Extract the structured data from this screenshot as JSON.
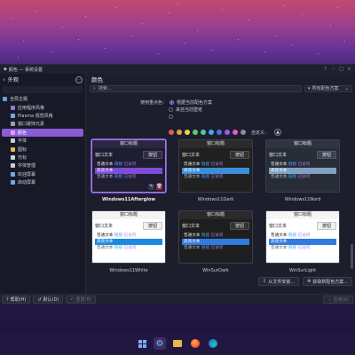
{
  "window": {
    "title": "颜色 — 系统设置",
    "title_icon": "palette-icon"
  },
  "sidebar": {
    "header": "外观",
    "items": [
      {
        "label": "全局主题",
        "icon": "globe-icon",
        "group": true,
        "color": "#5aa0e6"
      },
      {
        "label": "应用程序风格",
        "icon": "brush-icon",
        "color": "#8a7fd6"
      },
      {
        "label": "Plasma 视觉风格",
        "icon": "plasma-icon",
        "color": "#7aa6e8"
      },
      {
        "label": "窗口装饰元素",
        "icon": "window-icon",
        "color": "#9aa0b8"
      },
      {
        "label": "颜色",
        "icon": "palette-icon",
        "color": "#e0a0f0",
        "active": true
      },
      {
        "label": "字体",
        "icon": "font-icon",
        "color": "#c9cbd8"
      },
      {
        "label": "图标",
        "icon": "icons-icon",
        "color": "#e8b84a"
      },
      {
        "label": "光标",
        "icon": "cursor-icon",
        "color": "#d0d2e0"
      },
      {
        "label": "字体管理",
        "icon": "font-manager-icon",
        "color": "#c9cbd8"
      },
      {
        "label": "欢迎屏幕",
        "icon": "splash-icon",
        "color": "#6ab0e8"
      },
      {
        "label": "启动屏幕",
        "icon": "startup-icon",
        "color": "#7aa6e8"
      }
    ]
  },
  "main": {
    "title": "颜色",
    "search_placeholder": "搜索...",
    "filter_label": "所有配色方案",
    "accent": {
      "label": "使用重点色：",
      "option1": "根据当前配色方案",
      "option2": "来自当前壁纸"
    },
    "swatches": [
      "#e05a5a",
      "#e8a04a",
      "#e8d24a",
      "#5ad06a",
      "#4ac8b8",
      "#4aa8e8",
      "#5a6ae8",
      "#a05ae8",
      "#e05ac8",
      "#8a8ca0"
    ],
    "custom_label": "自定义："
  },
  "themes": [
    {
      "name": "Windows11Afterglow",
      "selected": true,
      "title_bg": "#2a2740",
      "title_fg": "#e4e6f0",
      "body_bg": "#1f1d30",
      "text": "#e4e6f0",
      "btn_bg": "#2f2c48",
      "btn_fg": "#e4e6f0",
      "sel_bg": "#7c4dd6",
      "sel_fg": "#ffffff"
    },
    {
      "name": "Windows11Dark",
      "selected": false,
      "title_bg": "#2b2b2b",
      "title_fg": "#e4e4e4",
      "body_bg": "#202020",
      "text": "#e4e4e4",
      "btn_bg": "#333333",
      "btn_fg": "#e4e4e4",
      "sel_bg": "#3b8fd9",
      "sel_fg": "#ffffff"
    },
    {
      "name": "Windows11Nord",
      "selected": false,
      "title_bg": "#2e3440",
      "title_fg": "#e5e9f0",
      "body_bg": "#272c36",
      "text": "#e5e9f0",
      "btn_bg": "#3b4252",
      "btn_fg": "#e5e9f0",
      "sel_bg": "#81a1c1",
      "sel_fg": "#ffffff"
    },
    {
      "name": "Windows11White",
      "selected": false,
      "title_bg": "#f3f3f3",
      "title_fg": "#202020",
      "body_bg": "#ffffff",
      "text": "#202020",
      "btn_bg": "#f0f0f0",
      "btn_fg": "#202020",
      "sel_bg": "#1a8ae0",
      "sel_fg": "#ffffff"
    },
    {
      "name": "WinSurDark",
      "selected": false,
      "title_bg": "#2a2a2a",
      "title_fg": "#e4e4e4",
      "body_bg": "#1e1e1e",
      "text": "#e4e4e4",
      "btn_bg": "#333333",
      "btn_fg": "#e4e4e4",
      "sel_bg": "#2f7be0",
      "sel_fg": "#ffffff"
    },
    {
      "name": "WinSurLight",
      "selected": false,
      "title_bg": "#f5f5f5",
      "title_fg": "#202020",
      "body_bg": "#ffffff",
      "text": "#202020",
      "btn_bg": "#f0f0f0",
      "btn_fg": "#202020",
      "sel_bg": "#2f7be0",
      "sel_fg": "#ffffff"
    }
  ],
  "preview": {
    "window_title": "窗口标题",
    "window_text": "窗口文本",
    "button": "按钮",
    "normal_text": "普通文本",
    "link": "链接",
    "visited": "已访问",
    "selected_text": "高亮文本"
  },
  "actions": {
    "install_from_file": "从文件安装...",
    "get_new": "获取新配色方案..."
  },
  "footer": {
    "help": "帮助(H)",
    "defaults": "默认(D)",
    "reset": "重置(R)",
    "apply": "应用(A)"
  },
  "taskbar": [
    {
      "icon": "start-icon",
      "active": false
    },
    {
      "icon": "settings-icon",
      "active": true
    },
    {
      "icon": "folder-icon",
      "active": false
    },
    {
      "icon": "firefox-icon",
      "active": false
    },
    {
      "icon": "edge-icon",
      "active": false
    }
  ]
}
